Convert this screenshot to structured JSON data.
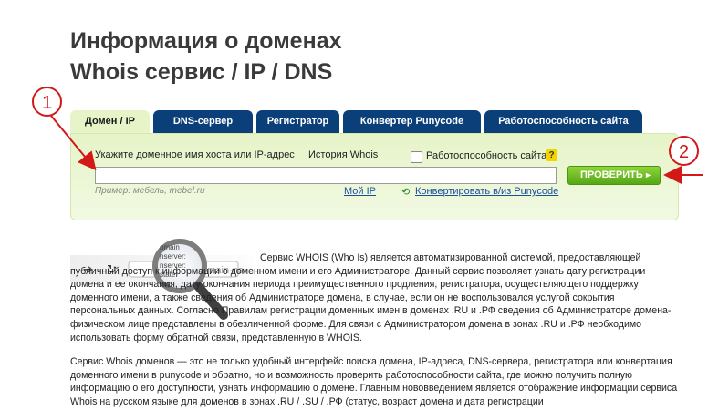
{
  "page": {
    "title_line1": "Информация о доменах",
    "title_line2": "Whois сервис / IP / DNS"
  },
  "tabs": [
    {
      "label": "Домен / IP",
      "active": true
    },
    {
      "label": "DNS-сервер",
      "active": false
    },
    {
      "label": "Регистратор",
      "active": false
    },
    {
      "label": "Конвертер Punycode",
      "active": false
    },
    {
      "label": "Работоспособность сайта",
      "active": false
    }
  ],
  "form": {
    "prompt": "Укажите доменное имя хоста или IP-адрес",
    "history_link": "История Whois",
    "availability_checkbox": "Работоспособность сайта",
    "availability_checked": false,
    "help_mark": "?",
    "input_value": "",
    "example": "Пример: мебель, mebel.ru",
    "my_ip_link": "Мой IP",
    "punycode_link": "Конвертировать в/из Punycode",
    "submit_label": "ПРОВЕРИТЬ"
  },
  "annotations": {
    "callout_1": "1",
    "callout_2": "2",
    "color": "#d31818"
  },
  "illustration": {
    "browser_text": "domain-na",
    "whois_lines": [
      "omain",
      "nserver:",
      "nserver:",
      "state:",
      "org:"
    ]
  },
  "article": {
    "p1": "Сервис WHOIS (Who Is) является автоматизированной системой, предоставляющей публичный доступ к информации о доменном имени и его Администраторе. Данный сервис позволяет узнать дату регистрации домена и ее окончания, дату окончания периода преимущественного продления, регистратора, осуществляющего поддержку доменного имени, а также сведения об Администраторе домена, в случае, если он не воспользовался услугой сокрытия персональных данных. Согласно Правилам регистрации доменных имен в доменах .RU и .РФ сведения об Администраторе домена-физическом лице представлены в обезличенной форме. Для связи с Администратором домена в зонах .RU и .РФ необходимо использовать форму обратной связи, представленную в WHOIS.",
    "p2": "Сервис Whois доменов — это не только удобный интерфейс поиска домена, IP-адреса, DNS-сервера, регистратора или конвертация доменного имени в punycode и обратно, но и возможность проверить работоспособности сайта, где можно получить полную информацию о его доступности, узнать информацию о домене. Главным нововведением является отображение информации сервиса Whois на русском языке для доменов в зонах .RU / .SU / .РФ (статус, возраст домена и дата регистрации"
  },
  "colors": {
    "tab_bg": "#0b3f7a",
    "panel_bg": "#e6f4c8",
    "button_green": "#5bb01a",
    "title": "#3a3a3a"
  }
}
